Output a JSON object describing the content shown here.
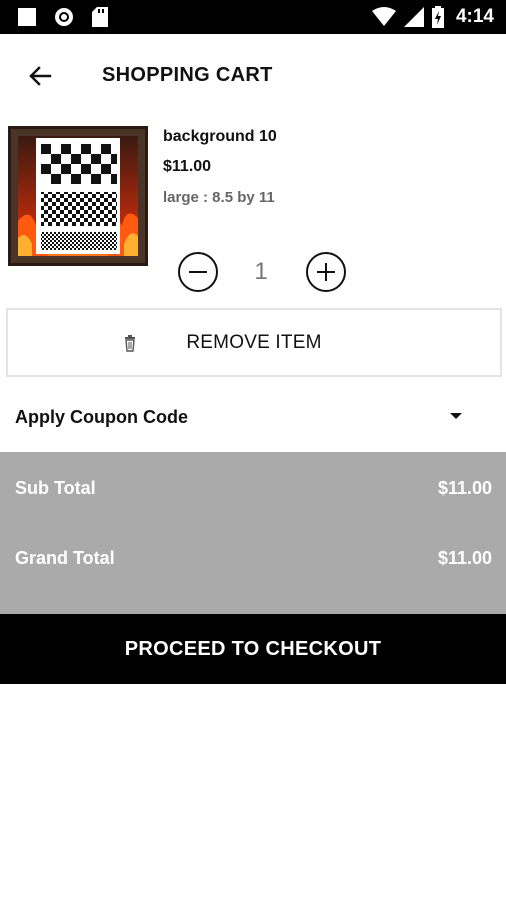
{
  "status_bar": {
    "time": "4:14",
    "icons": [
      "square-icon",
      "record-icon",
      "sd-card-icon",
      "wifi-icon",
      "cell-signal-icon",
      "battery-charging-icon"
    ]
  },
  "header": {
    "title": "SHOPPING CART",
    "back_icon": "arrow-back-icon"
  },
  "cart": {
    "item": {
      "name": "background 10",
      "price": "$11.00",
      "variant": "large : 8.5 by 11",
      "quantity": "1",
      "thumbnail_icon": "product-thumbnail"
    },
    "remove_label": "REMOVE ITEM",
    "remove_icon": "trash-icon"
  },
  "coupon": {
    "label": "Apply Coupon Code",
    "icon": "caret-down-icon"
  },
  "totals": {
    "sub_label": "Sub Total",
    "sub_value": "$11.00",
    "grand_label": "Grand Total",
    "grand_value": "$11.00"
  },
  "checkout": {
    "label": "PROCEED TO CHECKOUT"
  },
  "colors": {
    "status_bar": "#000000",
    "totals_bg": "#aaaaaa",
    "checkout_bg": "#000000",
    "variant_text": "#666666",
    "quantity_text": "#777777"
  }
}
